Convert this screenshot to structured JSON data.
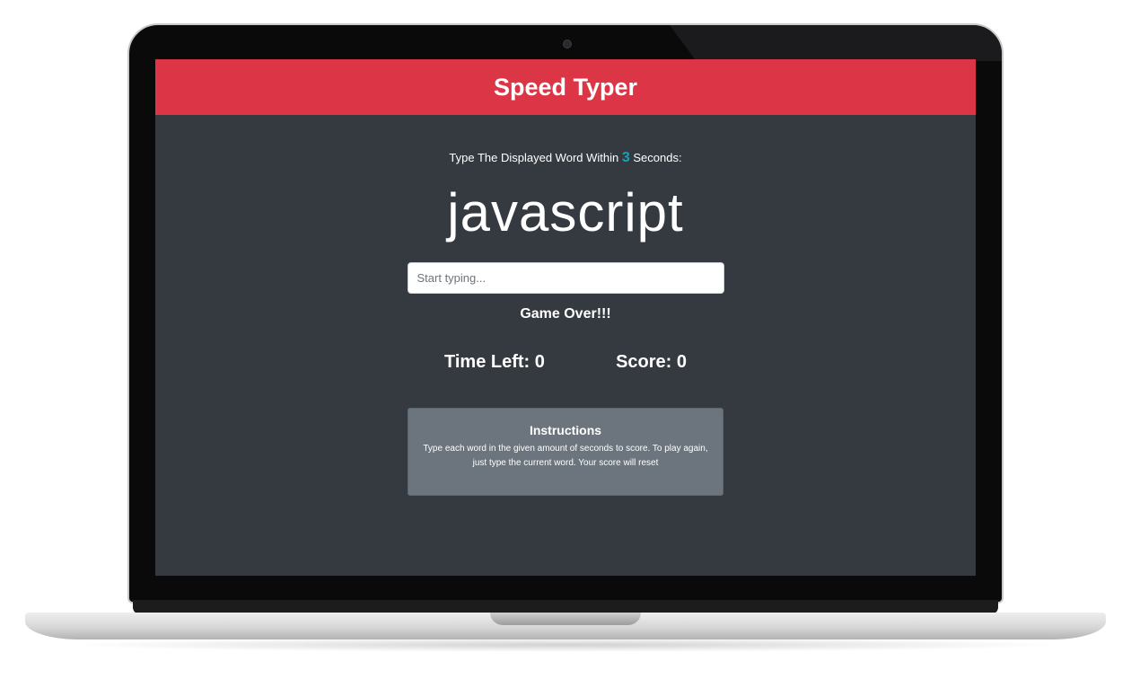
{
  "header": {
    "title": "Speed Typer",
    "color": "#dc3545"
  },
  "prompt": {
    "prefix": "Type The Displayed Word Within",
    "seconds": "3",
    "suffix": "Seconds:"
  },
  "current_word": "javascript",
  "input": {
    "value": "",
    "placeholder": "Start typing..."
  },
  "status_message": "Game Over!!!",
  "stats": {
    "time_left_label": "Time Left: ",
    "time_left": "0",
    "score_label": "Score: ",
    "score": "0"
  },
  "instructions": {
    "title": "Instructions",
    "text": "Type each word in the given amount of seconds to score. To play again, just type the current word. Your score will reset"
  },
  "colors": {
    "background": "#343a40",
    "accent": "#17a2b8",
    "card": "#6c757d"
  }
}
